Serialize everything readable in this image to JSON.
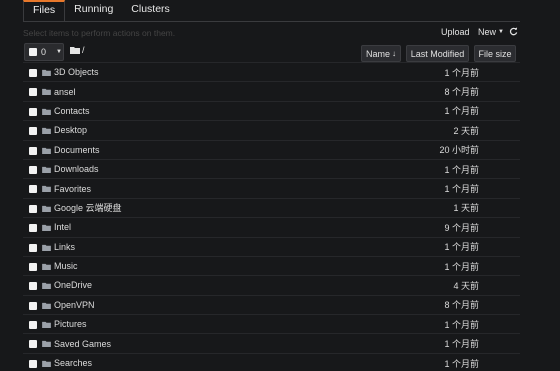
{
  "tabs": [
    {
      "label": "Files",
      "active": true
    },
    {
      "label": "Running",
      "active": false
    },
    {
      "label": "Clusters",
      "active": false
    }
  ],
  "toolbar": {
    "hint": "Select items to perform actions on them.",
    "upload_label": "Upload",
    "new_label": "New",
    "refresh_icon": "refresh-icon"
  },
  "selection": {
    "count": "0"
  },
  "breadcrumb": {
    "path": "/"
  },
  "sort": {
    "name_label": "Name",
    "name_arrow": "🡓",
    "modified_label": "Last Modified",
    "size_label": "File size"
  },
  "files": [
    {
      "name": "3D Objects",
      "modified": "1 个月前"
    },
    {
      "name": "ansel",
      "modified": "8 个月前"
    },
    {
      "name": "Contacts",
      "modified": "1 个月前"
    },
    {
      "name": "Desktop",
      "modified": "2 天前"
    },
    {
      "name": "Documents",
      "modified": "20 小时前"
    },
    {
      "name": "Downloads",
      "modified": "1 个月前"
    },
    {
      "name": "Favorites",
      "modified": "1 个月前"
    },
    {
      "name": "Google 云端硬盘",
      "modified": "1 天前"
    },
    {
      "name": "Intel",
      "modified": "9 个月前"
    },
    {
      "name": "Links",
      "modified": "1 个月前"
    },
    {
      "name": "Music",
      "modified": "1 个月前"
    },
    {
      "name": "OneDrive",
      "modified": "4 天前"
    },
    {
      "name": "OpenVPN",
      "modified": "8 个月前"
    },
    {
      "name": "Pictures",
      "modified": "1 个月前"
    },
    {
      "name": "Saved Games",
      "modified": "1 个月前"
    },
    {
      "name": "Searches",
      "modified": "1 个月前"
    }
  ],
  "colors": {
    "accent": "#e8782b",
    "folder": "#9aa0a8",
    "background": "#17181a"
  }
}
